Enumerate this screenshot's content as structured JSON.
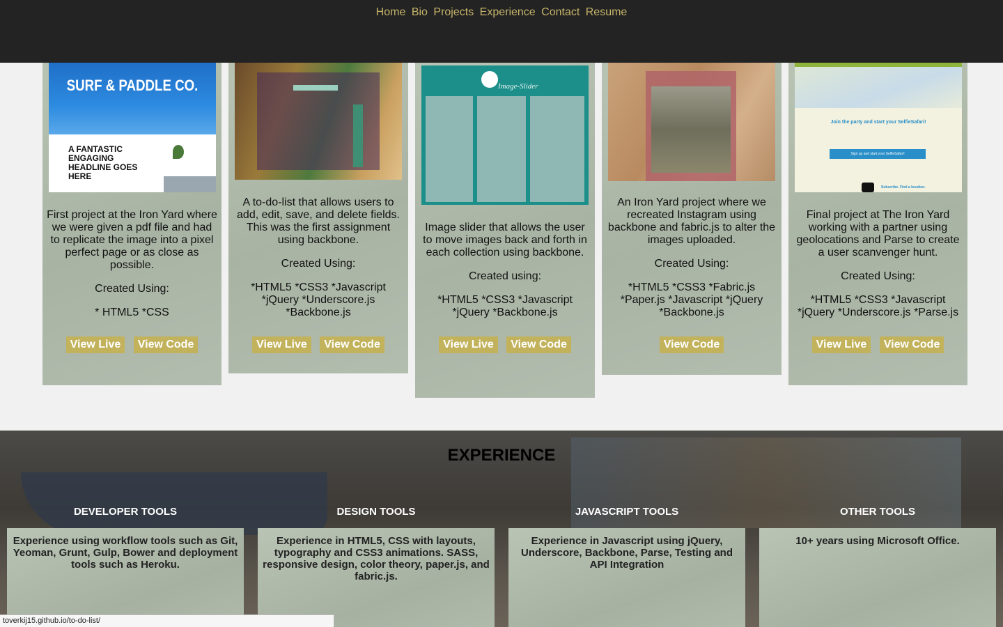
{
  "nav": [
    "Home",
    "Bio",
    "Projects",
    "Experience",
    "Contact",
    "Resume"
  ],
  "projects": [
    {
      "thumb_title": "SURF & PADDLE CO.",
      "thumb_headline": "A FANTASTIC ENGAGING HEADLINE GOES HERE",
      "description": "First project at the Iron Yard where we were given a pdf file and had to replicate the image into a pixel perfect page or as close as possible.",
      "created_label": "Created Using:",
      "tech": "* HTML5 *CSS",
      "buttons": [
        "View Live",
        "View Code"
      ]
    },
    {
      "description": "A to-do-list that allows users to add, edit, save, and delete fields. This was the first assignment using backbone.",
      "created_label": "Created Using:",
      "tech": "*HTML5 *CSS3 *Javascript\n*jQuery *Underscore.js\n*Backbone.js",
      "buttons": [
        "View Live",
        "View Code"
      ]
    },
    {
      "thumb_title": "Image-Slider",
      "description": "Image slider that allows the user to move images back and forth in each collection using backbone.",
      "created_label": "Created using:",
      "tech": "*HTML5 *CSS3 *Javascript\n*jQuery *Backbone.js",
      "buttons": [
        "View Live",
        "View Code"
      ]
    },
    {
      "description": "An Iron Yard project where we recreated Instagram using backbone and fabric.js to alter the images uploaded.",
      "created_label": "Created Using:",
      "tech": "*HTML5 *CSS3 *Fabric.js\n*Paper.js *Javascript *jQuery\n*Backbone.js",
      "buttons": [
        "View Code"
      ]
    },
    {
      "thumb_title": "Join the party and start your SelfieSafari!",
      "thumb_button": "Sign up and start your SelfieSafari!",
      "thumb_footer": "Subscribe. Find a location.",
      "description": "Final project at The Iron Yard working with a partner using geolocations and Parse to create a user scanvenger hunt.",
      "created_label": "Created Using:",
      "tech": "*HTML5 *CSS3 *Javascript\n*jQuery *Underscore.js *Parse.js",
      "buttons": [
        "View Live",
        "View Code"
      ]
    }
  ],
  "experience": {
    "title": "EXPERIENCE",
    "tools": [
      {
        "heading": "DEVELOPER TOOLS",
        "text": "Experience using workflow tools such as Git, Yeoman, Grunt, Gulp, Bower and deployment tools such as Heroku."
      },
      {
        "heading": "DESIGN TOOLS",
        "text": "Experience in HTML5, CSS with layouts, typography and CSS3 animations. SASS, responsive design, color theory, paper.js, and fabric.js."
      },
      {
        "heading": "JAVASCRIPT TOOLS",
        "text": "Experience in Javascript using jQuery, Underscore, Backbone, Parse, Testing and API Integration"
      },
      {
        "heading": "OTHER TOOLS",
        "text": "10+ years using Microsoft Office."
      }
    ]
  },
  "status_url": "toverkij15.github.io/to-do-list/",
  "colors": {
    "nav_bg": "#232323",
    "nav_link": "#c6b46a",
    "button_bg": "#c2b25c",
    "card_bg": "#b1bcac"
  }
}
